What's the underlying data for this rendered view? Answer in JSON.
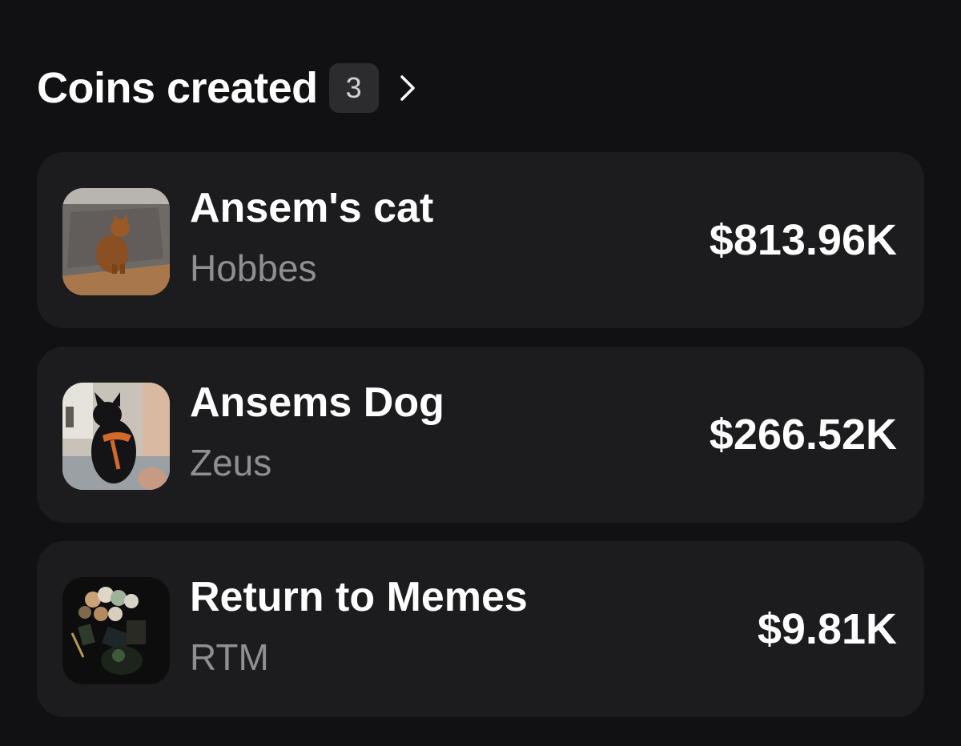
{
  "header": {
    "title": "Coins created",
    "count": "3",
    "chevron_icon": "chevron-right-icon"
  },
  "coins": [
    {
      "name": "Ansem's cat",
      "ticker": "Hobbes",
      "market_cap": "$813.96K",
      "image": "cat-photo"
    },
    {
      "name": "Ansems Dog",
      "ticker": "Zeus",
      "market_cap": "$266.52K",
      "image": "dog-photo"
    },
    {
      "name": "Return to Memes",
      "ticker": "RTM",
      "market_cap": "$9.81K",
      "image": "memes-collage"
    }
  ],
  "colors": {
    "background": "#111113",
    "card": "#1c1c1f",
    "badge": "#2c2c2f",
    "secondary_text": "#8e8e93"
  }
}
